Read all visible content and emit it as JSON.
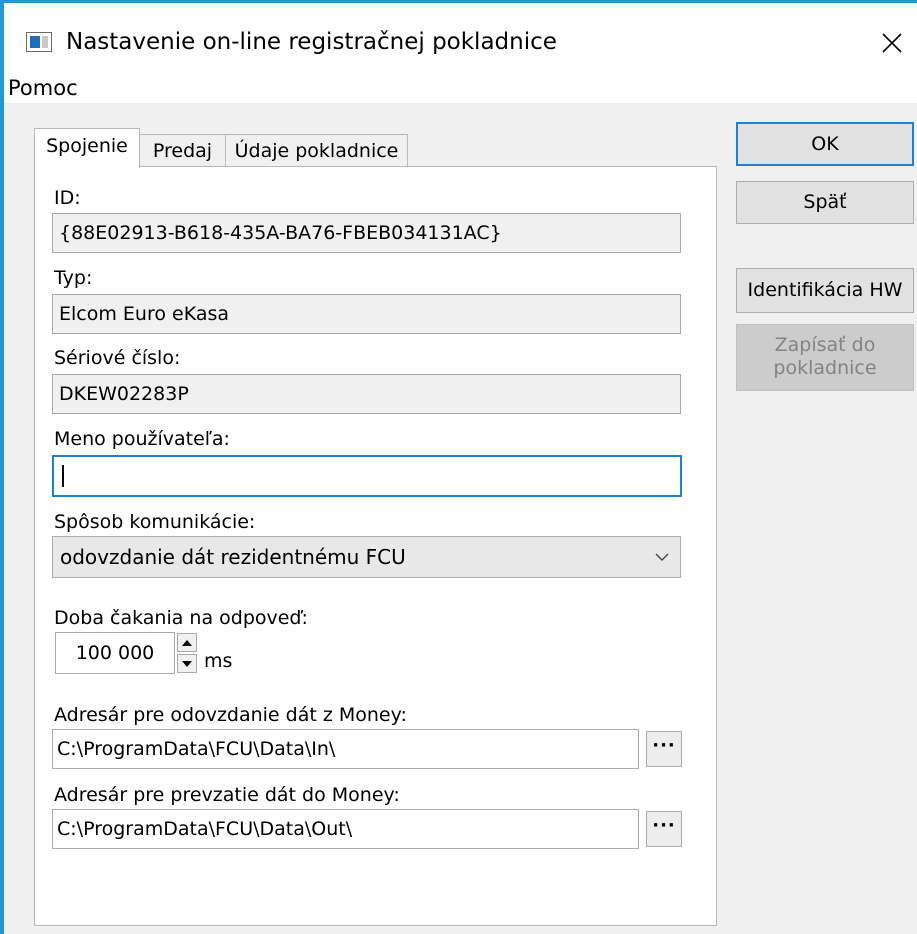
{
  "window": {
    "title": "Nastavenie on-line registračnej pokladnice",
    "close_symbol": "✕"
  },
  "menu": {
    "items": [
      {
        "label": "Pomoc"
      }
    ]
  },
  "tabs": [
    {
      "label": "Spojenie",
      "active": true
    },
    {
      "label": "Predaj",
      "active": false
    },
    {
      "label": "Údaje pokladnice",
      "active": false
    }
  ],
  "form": {
    "id": {
      "label": "ID:",
      "value": "{88E02913-B618-435A-BA76-FBEB034131AC}"
    },
    "type": {
      "label": "Typ:",
      "value": "Elcom Euro eKasa"
    },
    "serial": {
      "label": "Sériové číslo:",
      "value": "DKEW02283P"
    },
    "username": {
      "label": "Meno používateľa:",
      "value": ""
    },
    "comm_method": {
      "label": "Spôsob komunikácie:",
      "value": "odovzdanie dát rezidentnému FCU"
    },
    "timeout": {
      "label": "Doba čakania na odpoveď:",
      "value": "100 000",
      "unit": "ms"
    },
    "export_dir": {
      "label": "Adresár pre odovzdanie dát z Money:",
      "value": "C:\\ProgramData\\FCU\\Data\\In\\",
      "browse_label": "···"
    },
    "import_dir": {
      "label": "Adresár pre prevzatie dát do Money:",
      "value": "C:\\ProgramData\\FCU\\Data\\Out\\",
      "browse_label": "···"
    }
  },
  "buttons": {
    "ok": "OK",
    "back": "Späť",
    "hw_id": "Identifikácia HW",
    "write_line1": "Zapísať do",
    "write_line2": "pokladnice"
  },
  "colors": {
    "accent": "#1f9ad7",
    "focus": "#1f7fd1",
    "disabled_text": "#838383"
  },
  "icons": [
    "app-icon",
    "close-icon",
    "chevron-down-icon",
    "spin-up-icon",
    "spin-down-icon"
  ]
}
